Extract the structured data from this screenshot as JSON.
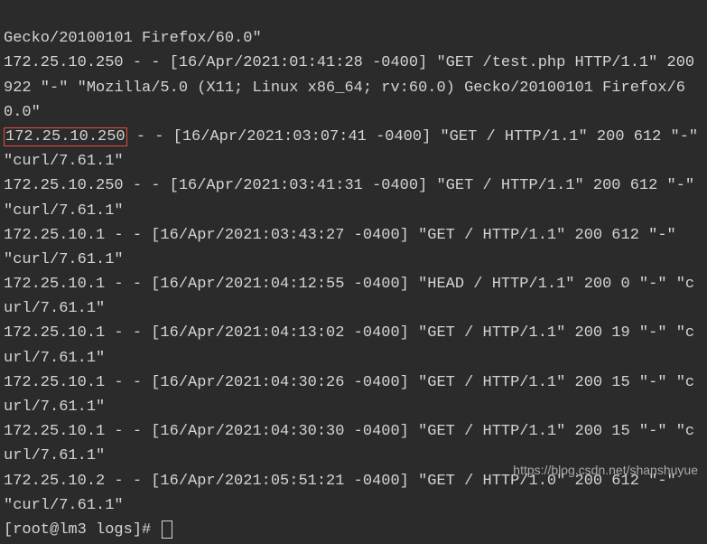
{
  "lines": {
    "l1": "Gecko/20100101 Firefox/60.0\"",
    "l2": "172.25.10.250 - - [16/Apr/2021:01:41:28 -0400] \"GET /test.php HTTP/1.1\" 200 922 \"-\" \"Mozilla/5.0 (X11; Linux x86_64; rv:60.0) Gecko/20100101 Firefox/60.0\"",
    "l3_ip": "172.25.10.250",
    "l3_rest": " - - [16/Apr/2021:03:07:41 -0400] \"GET / HTTP/1.1\" 200 612 \"-\" \"curl/7.61.1\"",
    "l4": "172.25.10.250 - - [16/Apr/2021:03:41:31 -0400] \"GET / HTTP/1.1\" 200 612 \"-\" \"curl/7.61.1\"",
    "l5": "172.25.10.1 - - [16/Apr/2021:03:43:27 -0400] \"GET / HTTP/1.1\" 200 612 \"-\" \"curl/7.61.1\"",
    "l6": "172.25.10.1 - - [16/Apr/2021:04:12:55 -0400] \"HEAD / HTTP/1.1\" 200 0 \"-\" \"curl/7.61.1\"",
    "l7": "172.25.10.1 - - [16/Apr/2021:04:13:02 -0400] \"GET / HTTP/1.1\" 200 19 \"-\" \"curl/7.61.1\"",
    "l8": "172.25.10.1 - - [16/Apr/2021:04:30:26 -0400] \"GET / HTTP/1.1\" 200 15 \"-\" \"curl/7.61.1\"",
    "l9": "172.25.10.1 - - [16/Apr/2021:04:30:30 -0400] \"GET / HTTP/1.1\" 200 15 \"-\" \"curl/7.61.1\"",
    "l10": "172.25.10.2 - - [16/Apr/2021:05:51:21 -0400] \"GET / HTTP/1.0\" 200 612 \"-\" \"curl/7.61.1\"",
    "prompt": "[root@lm3 logs]# "
  },
  "watermark": "https://blog.csdn.net/shanshuyue"
}
